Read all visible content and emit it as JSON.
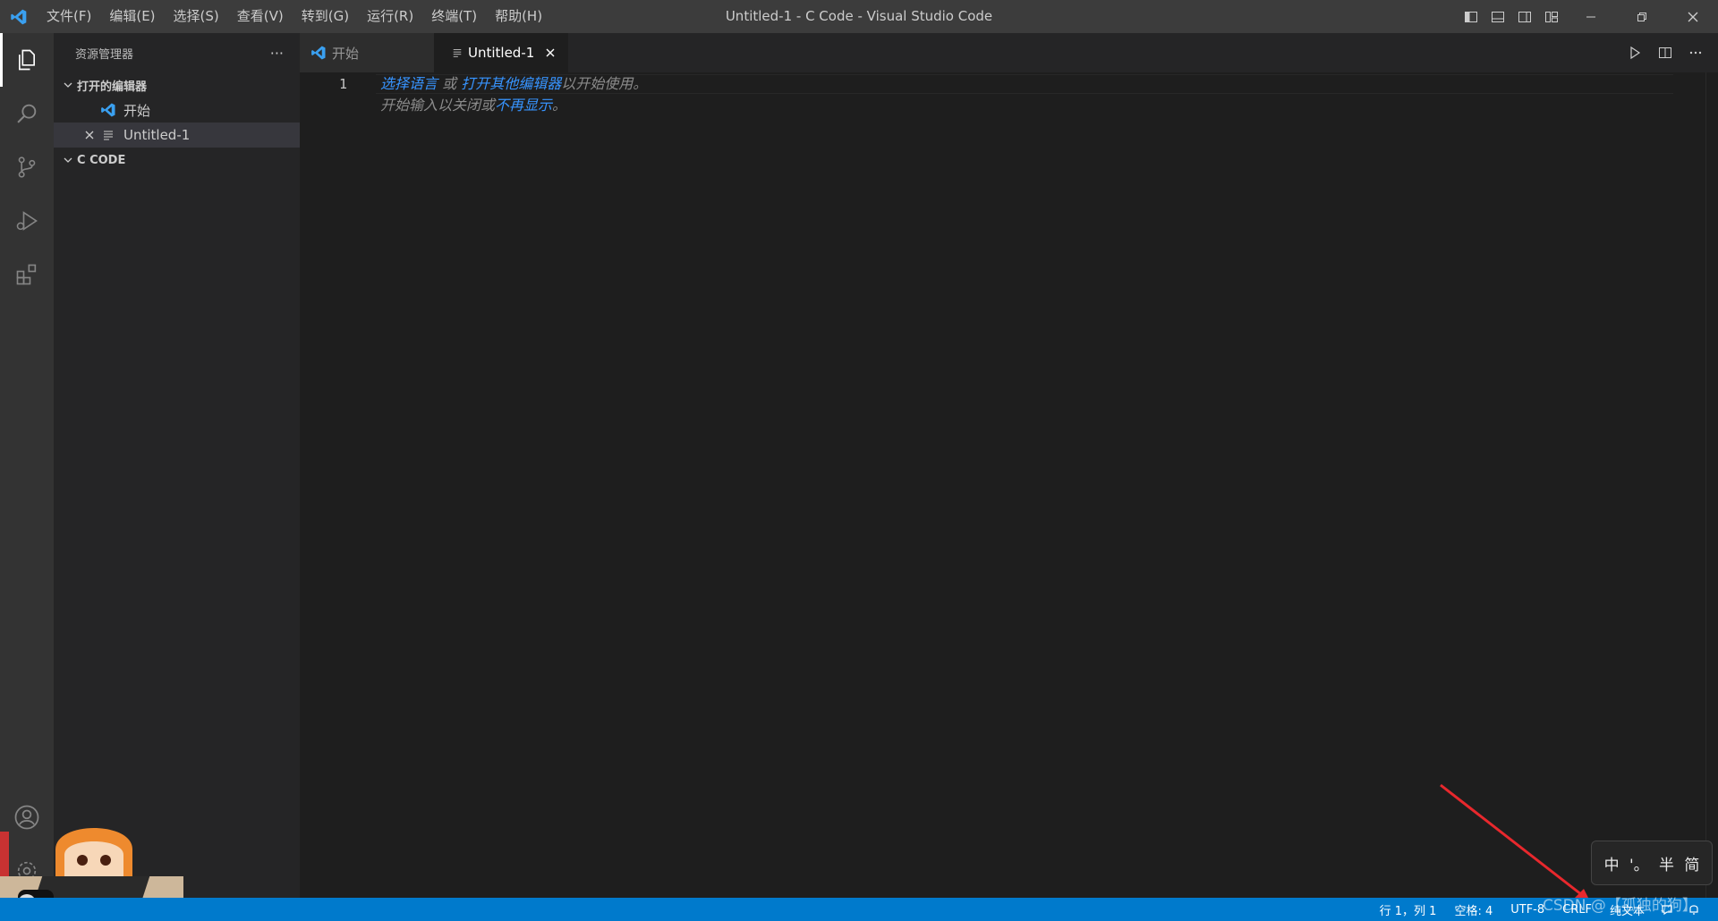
{
  "titlebar": {
    "menu": [
      "文件(F)",
      "编辑(E)",
      "选择(S)",
      "查看(V)",
      "转到(G)",
      "运行(R)",
      "终端(T)",
      "帮助(H)"
    ],
    "window_title": "Untitled-1 - C Code - Visual Studio Code"
  },
  "activitybar": {
    "items": [
      "explorer-icon",
      "search-icon",
      "source-control-icon",
      "run-debug-icon",
      "extensions-icon"
    ],
    "bottom": [
      "account-icon",
      "settings-icon"
    ]
  },
  "sidebar": {
    "title": "资源管理器",
    "more": "···",
    "open_editors": {
      "label": "打开的编辑器",
      "items": [
        {
          "name": "开始",
          "icon": "vscode-icon"
        },
        {
          "name": "Untitled-1",
          "icon": "text-file-icon",
          "selected": true
        }
      ]
    },
    "folder": {
      "label": "C CODE"
    }
  },
  "tabs": [
    {
      "label": "开始",
      "active": false
    },
    {
      "label": "Untitled-1",
      "active": true
    }
  ],
  "editor": {
    "line_number": "1",
    "hint_line1": {
      "link1": "选择语言",
      "sep": " 或 ",
      "link2": "打开其他编辑器",
      "rest": "以开始使用。"
    },
    "hint_line2": {
      "text": "开始输入以关闭或",
      "link": "不再显示",
      "end": "。"
    }
  },
  "statusbar": {
    "position": "行 1，列 1",
    "indent": "空格: 4",
    "encoding": "UTF-8",
    "eol": "CRLF",
    "language": "纯文本"
  },
  "ime": {
    "mode": "中",
    "punct": "'。",
    "width": "半",
    "script": "简"
  },
  "watermark": "CSDN @【孤独的狗】",
  "colors": {
    "accent": "#007acc",
    "link": "#3794ff",
    "titlebar": "#3c3c3c",
    "sidebar": "#252526",
    "editor": "#1e1e1e"
  }
}
